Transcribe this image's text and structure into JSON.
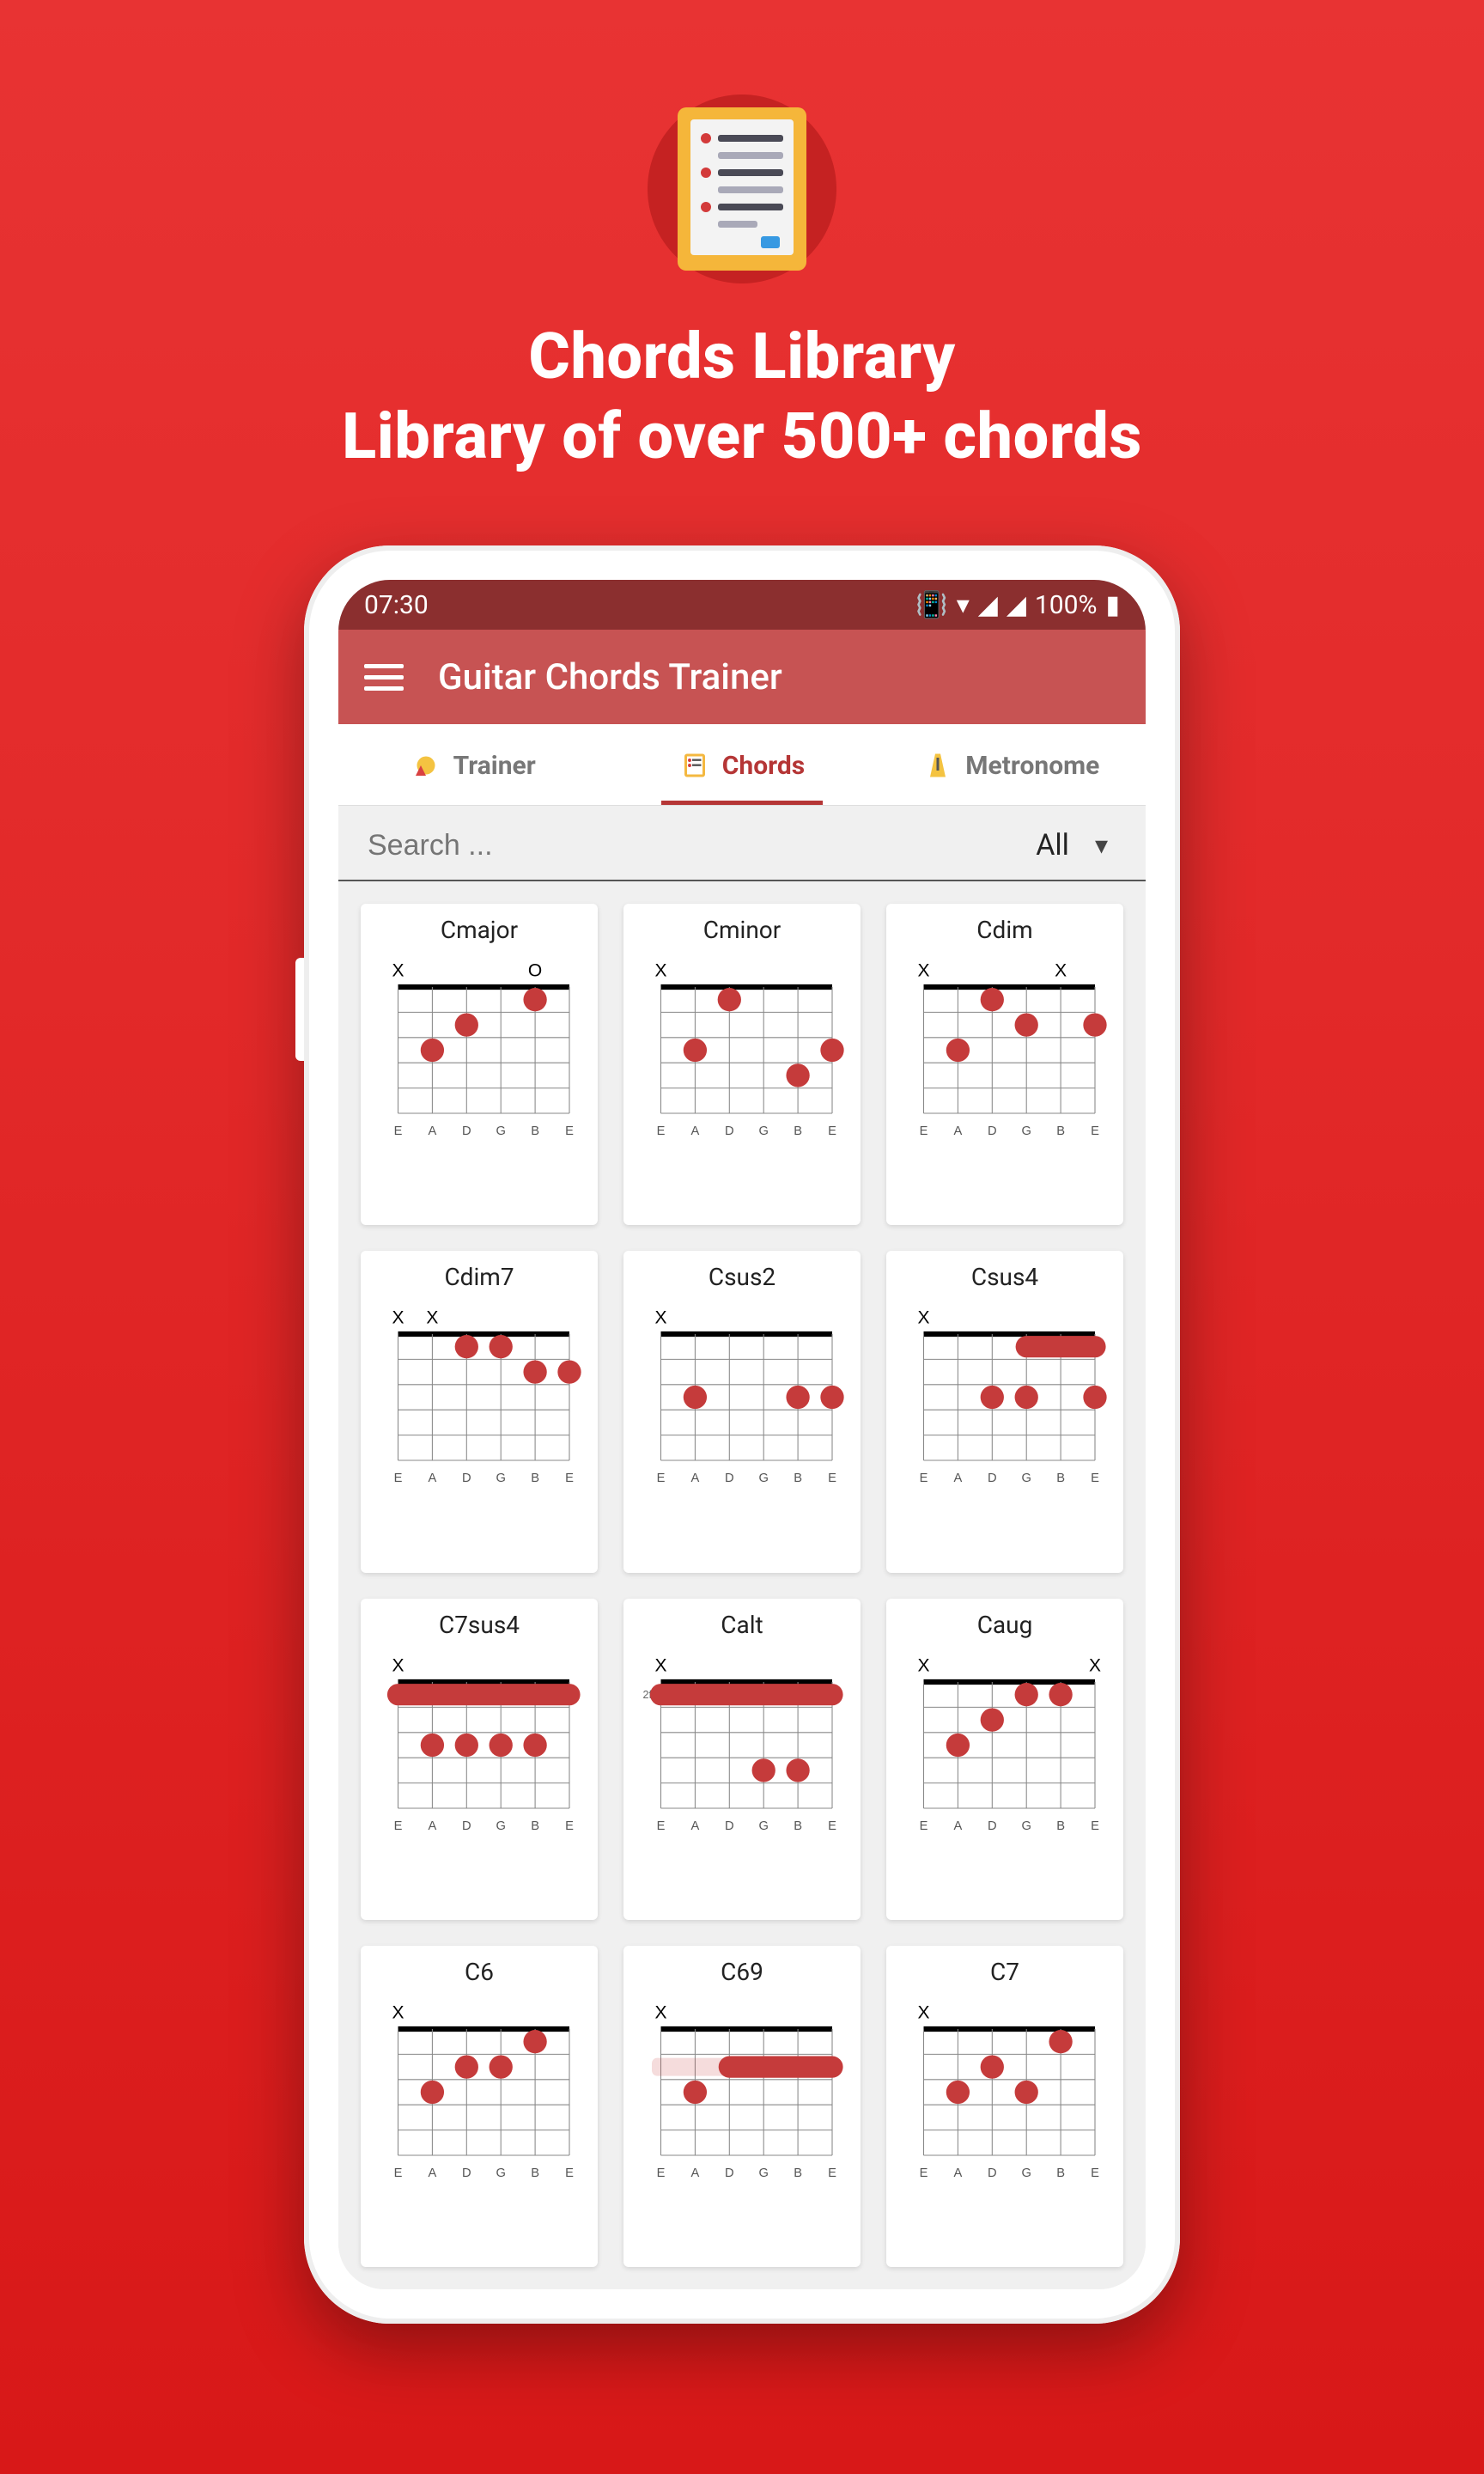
{
  "hero": {
    "title_line1": "Chords Library",
    "title_line2": "Library of over 500+ chords"
  },
  "status": {
    "time": "07:30",
    "battery": "100%"
  },
  "app": {
    "title": "Guitar Chords Trainer"
  },
  "tabs": [
    {
      "label": "Trainer",
      "active": false
    },
    {
      "label": "Chords",
      "active": true
    },
    {
      "label": "Metronome",
      "active": false
    }
  ],
  "search": {
    "placeholder": "Search ...",
    "filter": "All"
  },
  "string_labels": [
    "E",
    "A",
    "D",
    "G",
    "B",
    "E"
  ],
  "chords": [
    {
      "name": "Cmajor",
      "marks": [
        "X",
        "",
        "",
        "",
        "O",
        ""
      ],
      "dots": [
        {
          "s": 1,
          "f": 3
        },
        {
          "s": 2,
          "f": 2
        },
        {
          "s": 4,
          "f": 1
        }
      ]
    },
    {
      "name": "Cminor",
      "marks": [
        "X",
        "",
        "",
        "",
        "",
        ""
      ],
      "dots": [
        {
          "s": 1,
          "f": 3
        },
        {
          "s": 2,
          "f": 1
        },
        {
          "s": 4,
          "f": 4
        },
        {
          "s": 5,
          "f": 3
        }
      ]
    },
    {
      "name": "Cdim",
      "marks": [
        "X",
        "",
        "",
        "",
        "X",
        ""
      ],
      "dots": [
        {
          "s": 1,
          "f": 3
        },
        {
          "s": 2,
          "f": 1
        },
        {
          "s": 3,
          "f": 2
        },
        {
          "s": 5,
          "f": 2
        }
      ]
    },
    {
      "name": "Cdim7",
      "marks": [
        "X",
        "X",
        "",
        "",
        "",
        ""
      ],
      "dots": [
        {
          "s": 2,
          "f": 1
        },
        {
          "s": 3,
          "f": 1
        },
        {
          "s": 4,
          "f": 2
        },
        {
          "s": 5,
          "f": 2
        }
      ]
    },
    {
      "name": "Csus2",
      "marks": [
        "X",
        "",
        "",
        "",
        "",
        ""
      ],
      "dots": [
        {
          "s": 1,
          "f": 3
        },
        {
          "s": 4,
          "f": 3
        },
        {
          "s": 5,
          "f": 3
        }
      ]
    },
    {
      "name": "Csus4",
      "marks": [
        "X",
        "",
        "",
        "",
        "",
        ""
      ],
      "dots": [
        {
          "s": 2,
          "f": 3
        },
        {
          "s": 3,
          "f": 3
        },
        {
          "s": 5,
          "f": 3
        }
      ],
      "barre": {
        "fret": 1,
        "from": 3,
        "to": 5
      }
    },
    {
      "name": "C7sus4",
      "marks": [
        "X",
        "",
        "",
        "",
        "",
        ""
      ],
      "dots": [
        {
          "s": 1,
          "f": 3
        },
        {
          "s": 2,
          "f": 3
        },
        {
          "s": 3,
          "f": 3
        },
        {
          "s": 4,
          "f": 3
        }
      ],
      "barre": {
        "fret": 1,
        "from": 0,
        "to": 5
      },
      "shadow": 1
    },
    {
      "name": "Calt",
      "marks": [
        "X",
        "",
        "",
        "",
        "",
        ""
      ],
      "dots": [
        {
          "s": 3,
          "f": 4
        },
        {
          "s": 4,
          "f": 4
        }
      ],
      "barre": {
        "fret": 1,
        "from": 0,
        "to": 5
      },
      "startFret": 2
    },
    {
      "name": "Caug",
      "marks": [
        "X",
        "",
        "",
        "",
        "",
        "X"
      ],
      "dots": [
        {
          "s": 1,
          "f": 3
        },
        {
          "s": 2,
          "f": 2
        },
        {
          "s": 3,
          "f": 1
        },
        {
          "s": 4,
          "f": 1
        }
      ]
    },
    {
      "name": "C6",
      "marks": [
        "X",
        "",
        "",
        "",
        "",
        ""
      ],
      "dots": [
        {
          "s": 1,
          "f": 3
        },
        {
          "s": 2,
          "f": 2
        },
        {
          "s": 3,
          "f": 2
        },
        {
          "s": 4,
          "f": 1
        }
      ]
    },
    {
      "name": "C69",
      "marks": [
        "X",
        "",
        "",
        "",
        "",
        ""
      ],
      "dots": [
        {
          "s": 1,
          "f": 3
        }
      ],
      "barre": {
        "fret": 2,
        "from": 2,
        "to": 5
      },
      "shadow": 2
    },
    {
      "name": "C7",
      "marks": [
        "X",
        "",
        "",
        "",
        "",
        ""
      ],
      "dots": [
        {
          "s": 1,
          "f": 3
        },
        {
          "s": 2,
          "f": 2
        },
        {
          "s": 3,
          "f": 3
        },
        {
          "s": 4,
          "f": 1
        }
      ]
    }
  ]
}
